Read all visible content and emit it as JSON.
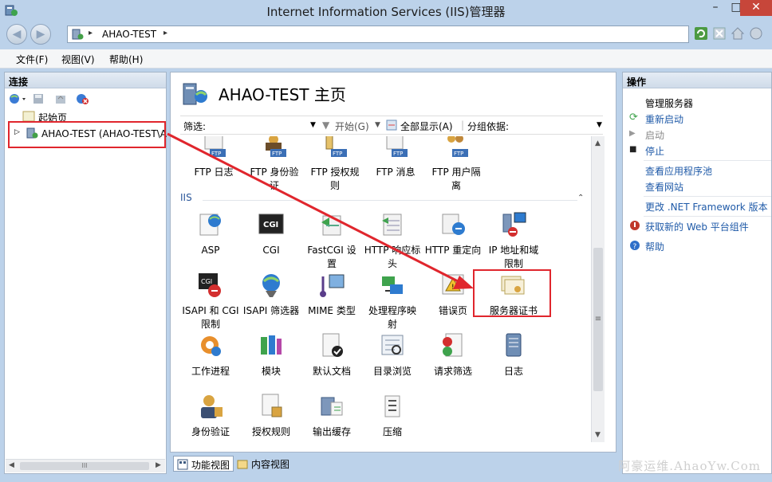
{
  "window": {
    "title": "Internet Information Services (IIS)管理器"
  },
  "address": {
    "crumb": "AHAO-TEST",
    "sep": "▸"
  },
  "menu": [
    "文件(F)",
    "视图(V)",
    "帮助(H)"
  ],
  "left": {
    "header": "连接",
    "start_page": "起始页",
    "server_node": "AHAO-TEST (AHAO-TEST\\A",
    "scroll_grip": "III"
  },
  "center": {
    "title": "AHAO-TEST 主页",
    "filter_label": "筛选:",
    "start_label": "开始(G)",
    "show_all_label": "全部显示(A)",
    "group_label": "分组依据:",
    "group_iis": "IIS",
    "ftp_items": [
      {
        "label": "FTP 日志"
      },
      {
        "label": "FTP 身份验\n证"
      },
      {
        "label": "FTP 授权规\n则"
      },
      {
        "label": "FTP 消息"
      },
      {
        "label": "FTP 用户隔\n离"
      }
    ],
    "iis_items": [
      {
        "label": "ASP"
      },
      {
        "label": "CGI"
      },
      {
        "label": "FastCGI 设\n置"
      },
      {
        "label": "HTTP 响应标\n头"
      },
      {
        "label": "HTTP 重定向"
      },
      {
        "label": "IP 地址和域\n限制"
      },
      {
        "label": "ISAPI 和 CGI\n限制"
      },
      {
        "label": "ISAPI 筛选器"
      },
      {
        "label": "MIME 类型"
      },
      {
        "label": "处理程序映\n射"
      },
      {
        "label": "错误页"
      },
      {
        "label": "服务器证书"
      },
      {
        "label": "工作进程"
      },
      {
        "label": "模块"
      },
      {
        "label": "默认文档"
      },
      {
        "label": "目录浏览"
      },
      {
        "label": "请求筛选"
      },
      {
        "label": "日志"
      },
      {
        "label": "身份验证"
      },
      {
        "label": "授权规则"
      },
      {
        "label": "输出缓存"
      },
      {
        "label": "压缩"
      }
    ],
    "view_tabs": {
      "features": "功能视图",
      "content": "内容视图"
    },
    "scroll_grip": "≡"
  },
  "right": {
    "header": "操作",
    "manage_server": "管理服务器",
    "restart": "重新启动",
    "start": "启动",
    "stop": "停止",
    "view_pools": "查看应用程序池",
    "view_sites": "查看网站",
    "change_net": "更改 .NET Framework 版本",
    "get_components": "获取新的 Web 平台组件",
    "help": "帮助"
  },
  "watermark": "阿豪运维.AhaoYw.Com",
  "colors": {
    "annotation": "#e0262d",
    "link": "#1f5aa8",
    "titlebar": "#bcd2ea"
  }
}
